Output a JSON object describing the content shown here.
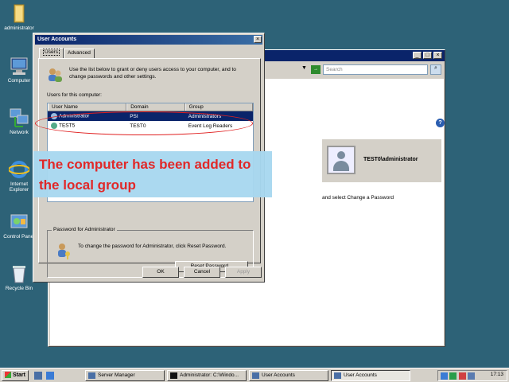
{
  "desktop": {
    "icons": [
      {
        "label": "administrator",
        "icon": "folder-icon"
      },
      {
        "label": "Computer",
        "icon": "computer-icon"
      },
      {
        "label": "Network",
        "icon": "network-icon"
      },
      {
        "label": "Internet Explorer",
        "icon": "ie-icon"
      },
      {
        "label": "Control Panel",
        "icon": "control-panel-icon"
      },
      {
        "label": "Recycle Bin",
        "icon": "recycle-bin-icon"
      }
    ]
  },
  "bg_window": {
    "search_placeholder": "Search",
    "user_name": "TEST0\\administrator",
    "password_hint": "and select Change a Password"
  },
  "dialog": {
    "title": "User Accounts",
    "tabs": [
      "Users",
      "Advanced"
    ],
    "intro": "Use the list below to grant or deny users access to your computer, and to change passwords and other settings.",
    "users_for_label": "Users for this computer:",
    "columns": [
      "User Name",
      "Domain",
      "Group"
    ],
    "rows": [
      {
        "user": "Administrator",
        "domain": "PSI",
        "group": "Administrators",
        "selected": true
      },
      {
        "user": "TEST5",
        "domain": "TEST0",
        "group": "Event Log Readers",
        "selected": false
      }
    ],
    "password_group": {
      "legend": "Password for Administrator",
      "text": "To change the password for Administrator, click Reset Password.",
      "reset_button": "Reset Password..."
    },
    "buttons": {
      "ok": "OK",
      "cancel": "Cancel",
      "apply": "Apply"
    }
  },
  "overlay_caption": "The computer has been added to the local group",
  "taskbar": {
    "start": "Start",
    "tasks": [
      {
        "label": "Server Manager",
        "active": false
      },
      {
        "label": "Administrator: C:\\Windo...",
        "active": false
      },
      {
        "label": "User Accounts",
        "active": false
      },
      {
        "label": "User Accounts",
        "active": true
      }
    ],
    "clock": "17:13"
  }
}
